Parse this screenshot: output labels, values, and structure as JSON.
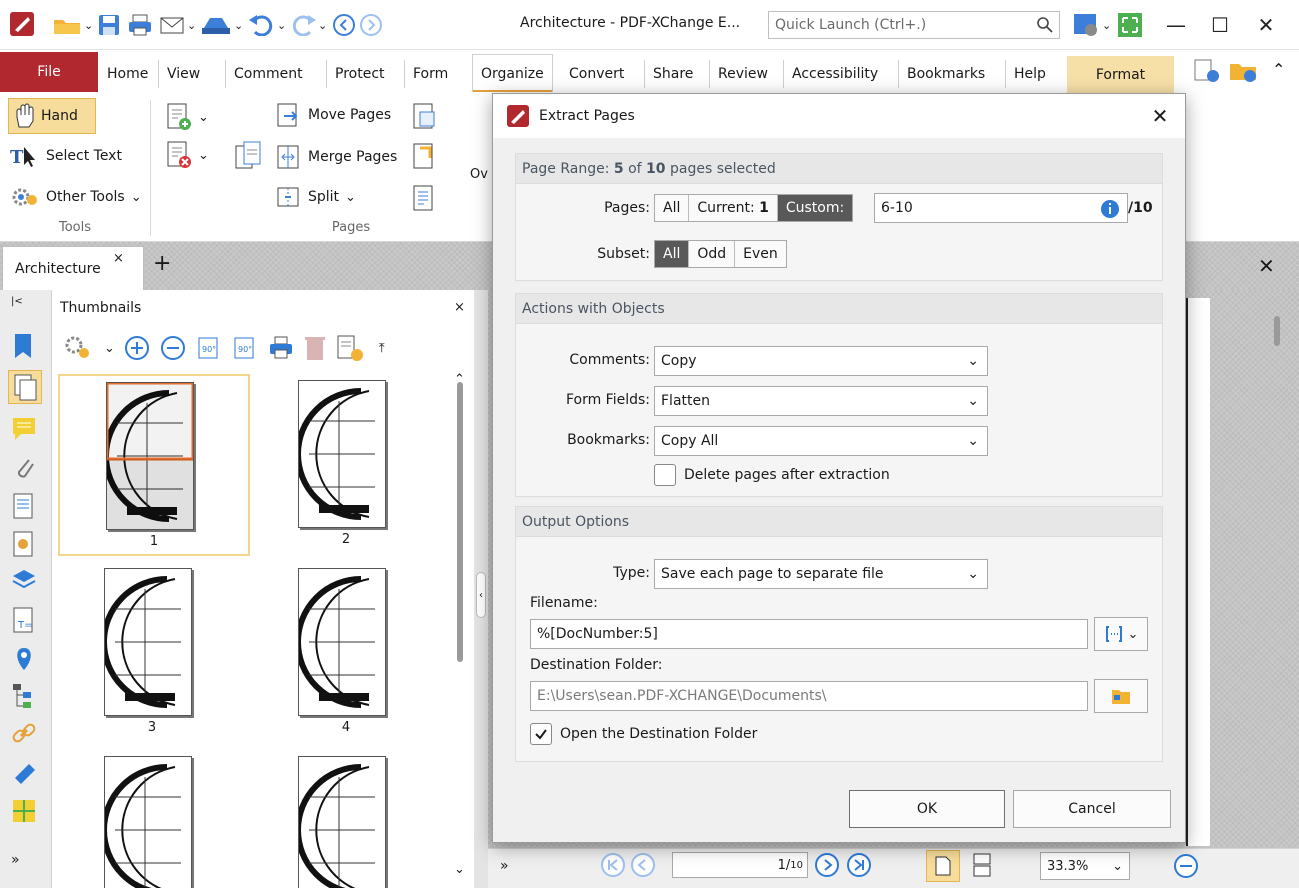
{
  "window": {
    "title": "Architecture - PDF-XChange E...",
    "quick_launch_placeholder": "Quick Launch (Ctrl+.)",
    "minimize": "—",
    "maximize": "☐",
    "close": "✕"
  },
  "ribbon_tabs": [
    "File",
    "Home",
    "View",
    "Comment",
    "Protect",
    "Form",
    "Organize",
    "Convert",
    "Share",
    "Review",
    "Accessibility",
    "Bookmarks",
    "Help",
    "Format"
  ],
  "active_tab": "Organize",
  "ribbon": {
    "tools": {
      "hand": "Hand",
      "select_text": "Select Text",
      "other_tools": "Other Tools",
      "group": "Tools"
    },
    "pages": {
      "move_pages": "Move Pages",
      "merge_pages": "Merge Pages",
      "split": "Split",
      "group": "Pages",
      "overflow": "Ov"
    }
  },
  "doc_tab": {
    "label": "Architecture",
    "close": "×",
    "add": "+"
  },
  "thumbnails": {
    "title": "Thumbnails",
    "close": "×",
    "pages": [
      "1",
      "2",
      "3",
      "4"
    ]
  },
  "bottom_bar": {
    "page_current": "1",
    "page_total": "10",
    "zoom": "33.3%"
  },
  "dialog": {
    "title": "Extract Pages",
    "close": "✕",
    "page_range": {
      "prefix": "Page Range: ",
      "selected": "5",
      "middle": " of ",
      "total": "10",
      "suffix": " pages selected",
      "pages_label": "Pages:",
      "all": "All",
      "current_prefix": "Current: ",
      "current_value": "1",
      "custom": "Custom:",
      "custom_value": "6-10",
      "of_total": "/10",
      "subset_label": "Subset:",
      "subset_all": "All",
      "subset_odd": "Odd",
      "subset_even": "Even"
    },
    "actions": {
      "heading": "Actions with Objects",
      "comments_label": "Comments:",
      "comments_value": "Copy",
      "form_fields_label": "Form Fields:",
      "form_fields_value": "Flatten",
      "bookmarks_label": "Bookmarks:",
      "bookmarks_value": "Copy All",
      "delete_after": "Delete pages after extraction"
    },
    "output": {
      "heading": "Output Options",
      "type_label": "Type:",
      "type_value": "Save each page to separate file",
      "filename_label": "Filename:",
      "filename_value": "%[DocNumber:5]",
      "dest_label": "Destination Folder:",
      "dest_value": "E:\\Users\\sean.PDF-XCHANGE\\Documents\\",
      "open_dest": "Open the Destination Folder"
    },
    "ok": "OK",
    "cancel": "Cancel"
  },
  "colors": {
    "brand": "#b1292f",
    "accent": "#e5a13a",
    "icon_blue": "#2e7bd6",
    "format_tab": "#f7e0a8"
  }
}
